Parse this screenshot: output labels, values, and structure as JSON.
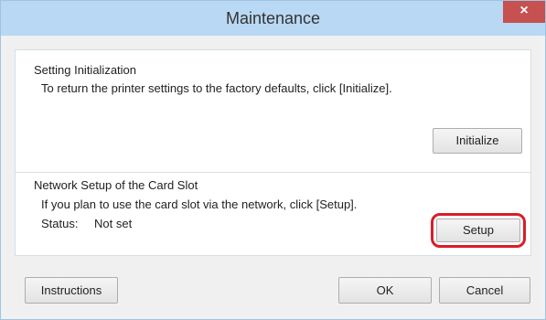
{
  "window": {
    "title": "Maintenance",
    "close_glyph": "×"
  },
  "setting_initialization": {
    "heading": "Setting Initialization",
    "description": "To return the printer settings to the factory defaults, click [Initialize].",
    "initialize_button": "Initialize"
  },
  "network_setup": {
    "heading": "Network Setup of the Card Slot",
    "description": "If you plan to use the card slot via the network, click [Setup].",
    "status_label": "Status:",
    "status_value": "Not set",
    "setup_button": "Setup"
  },
  "footer": {
    "instructions_button": "Instructions",
    "ok_button": "OK",
    "cancel_button": "Cancel"
  },
  "colors": {
    "titlebar": "#b9d8f3",
    "close_button": "#c75050",
    "highlight_ring": "#d81e2a"
  },
  "icons": {
    "close": "close-icon"
  }
}
